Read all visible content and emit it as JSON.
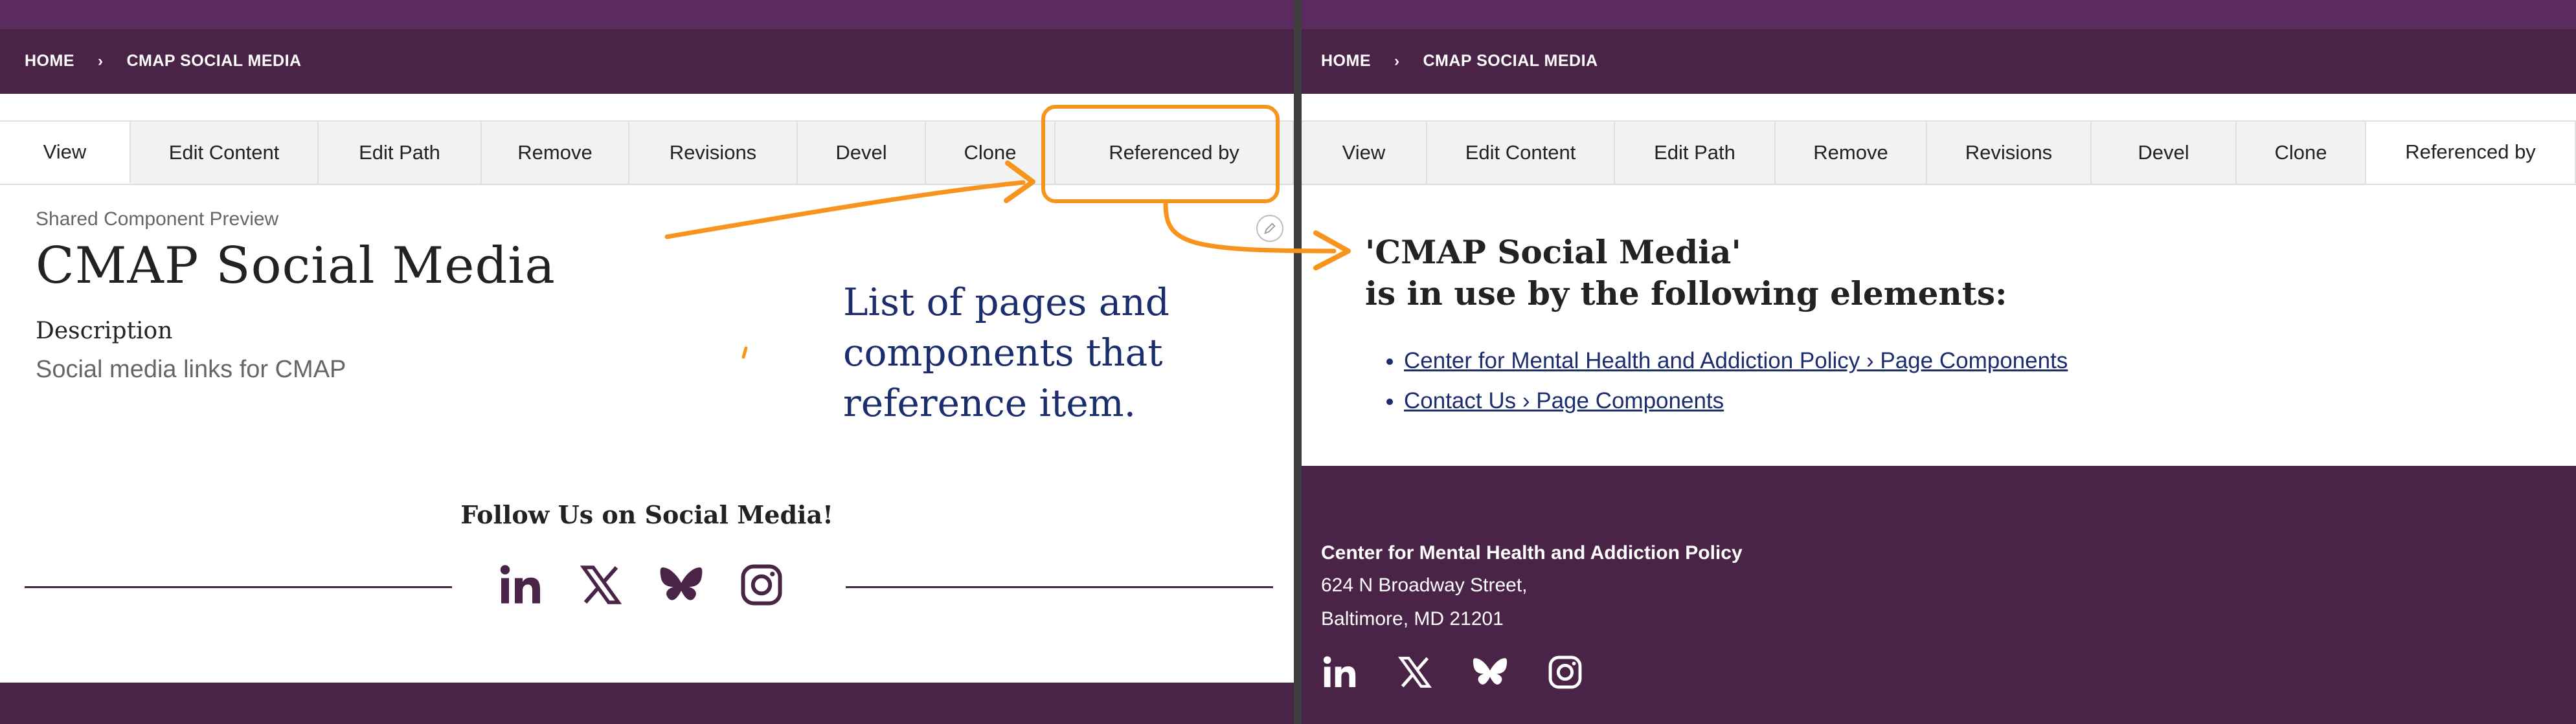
{
  "breadcrumb": {
    "home": "HOME",
    "separator": "›",
    "current": "CMAP SOCIAL MEDIA"
  },
  "tabs": [
    "View",
    "Edit Content",
    "Edit Path",
    "Remove",
    "Revisions",
    "Devel",
    "Clone",
    "Referenced by"
  ],
  "left": {
    "active_tab": "View",
    "preview_label": "Shared Component Preview",
    "title": "CMAP Social Media",
    "description_label": "Description",
    "description_value": "Social media links for CMAP",
    "follow_title": "Follow Us on Social Media!",
    "social_icons": [
      "linkedin-icon",
      "x-icon",
      "bluesky-icon",
      "instagram-icon"
    ]
  },
  "annotation": {
    "note_lines": [
      "List of pages and",
      "components that",
      "reference item."
    ],
    "color": "#f7941d"
  },
  "right": {
    "active_tab": "Referenced by",
    "heading_line1": "'CMAP Social Media'",
    "heading_line2": "is in use by the following elements:",
    "references": [
      "Center for Mental Health and Addiction Policy › Page Components",
      "Contact Us › Page Components"
    ],
    "footer": {
      "name": "Center for Mental Health and Addiction Policy",
      "address_line1": "624 N Broadway Street,",
      "address_line2": "Baltimore, MD 21201"
    }
  },
  "colors": {
    "brand_purple": "#4a2447",
    "top_purple": "#5b2a5e",
    "link_blue": "#1c2d6e",
    "highlight_orange": "#f7941d"
  }
}
